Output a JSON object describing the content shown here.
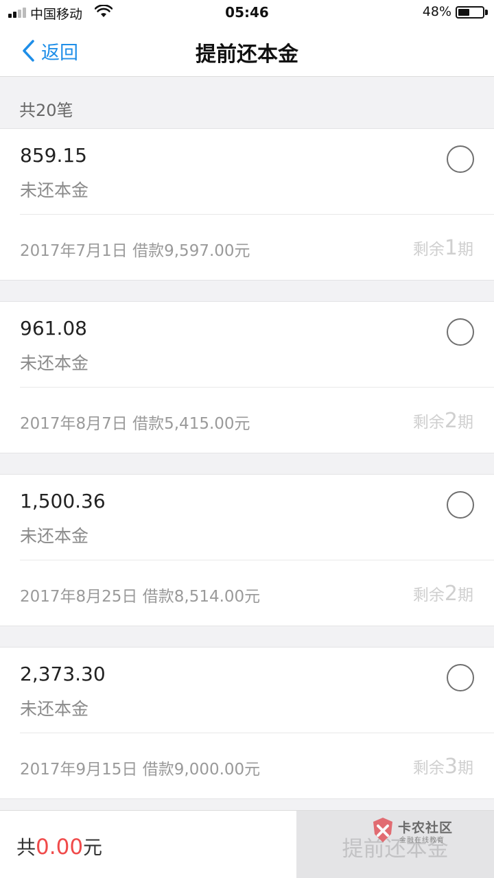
{
  "status_bar": {
    "carrier": "中国移动",
    "time": "05:46",
    "battery_percent": "48%",
    "battery_level": 0.48
  },
  "nav": {
    "back_label": "返回",
    "title": "提前还本金"
  },
  "count_header": "共20笔",
  "loans": [
    {
      "amount": "859.15",
      "amount_label": "未还本金",
      "loan_info": "2017年7月1日 借款9,597.00元",
      "remaining_prefix": "剩余",
      "remaining_num": "1",
      "remaining_suffix": "期"
    },
    {
      "amount": "961.08",
      "amount_label": "未还本金",
      "loan_info": "2017年8月7日 借款5,415.00元",
      "remaining_prefix": "剩余",
      "remaining_num": "2",
      "remaining_suffix": "期"
    },
    {
      "amount": "1,500.36",
      "amount_label": "未还本金",
      "loan_info": "2017年8月25日 借款8,514.00元",
      "remaining_prefix": "剩余",
      "remaining_num": "2",
      "remaining_suffix": "期"
    },
    {
      "amount": "2,373.30",
      "amount_label": "未还本金",
      "loan_info": "2017年9月15日 借款9,000.00元",
      "remaining_prefix": "剩余",
      "remaining_num": "3",
      "remaining_suffix": "期"
    }
  ],
  "bottom_bar": {
    "total_prefix": "共",
    "total_amount": "0.00",
    "total_suffix": "元",
    "submit_label": "提前还本金"
  },
  "watermark": {
    "title": "卡农社区",
    "subtitle": "金融在线教育"
  },
  "colors": {
    "accent": "#1e8ee8",
    "total_amount": "#f04a4a"
  }
}
